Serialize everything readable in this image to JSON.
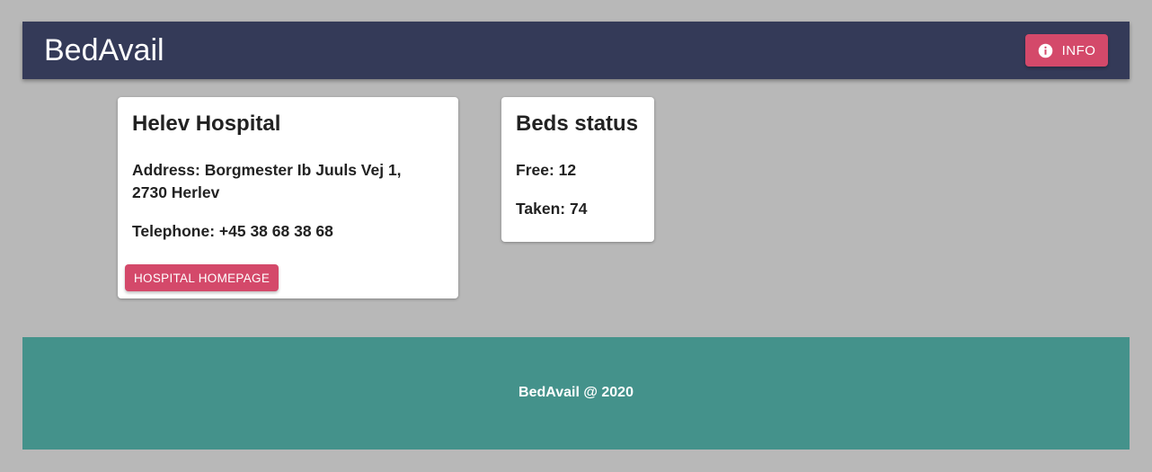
{
  "header": {
    "brand": "BedAvail",
    "info_button": {
      "label": "INFO",
      "icon": "info-circle-icon"
    }
  },
  "hospital_card": {
    "title": "Helev Hospital",
    "address": "Address: Borgmester Ib Juuls Vej 1, 2730 Herlev",
    "telephone": "Telephone: +45 38 68 38 68",
    "homepage_button": "HOSPITAL HOMEPAGE"
  },
  "beds_card": {
    "title": "Beds status",
    "free": "Free: 12",
    "taken": "Taken: 74"
  },
  "footer": {
    "text": "BedAvail @ 2020"
  },
  "colors": {
    "background": "#b8b8b8",
    "header": "#343a58",
    "accent": "#d4496a",
    "footer": "#44928b"
  }
}
